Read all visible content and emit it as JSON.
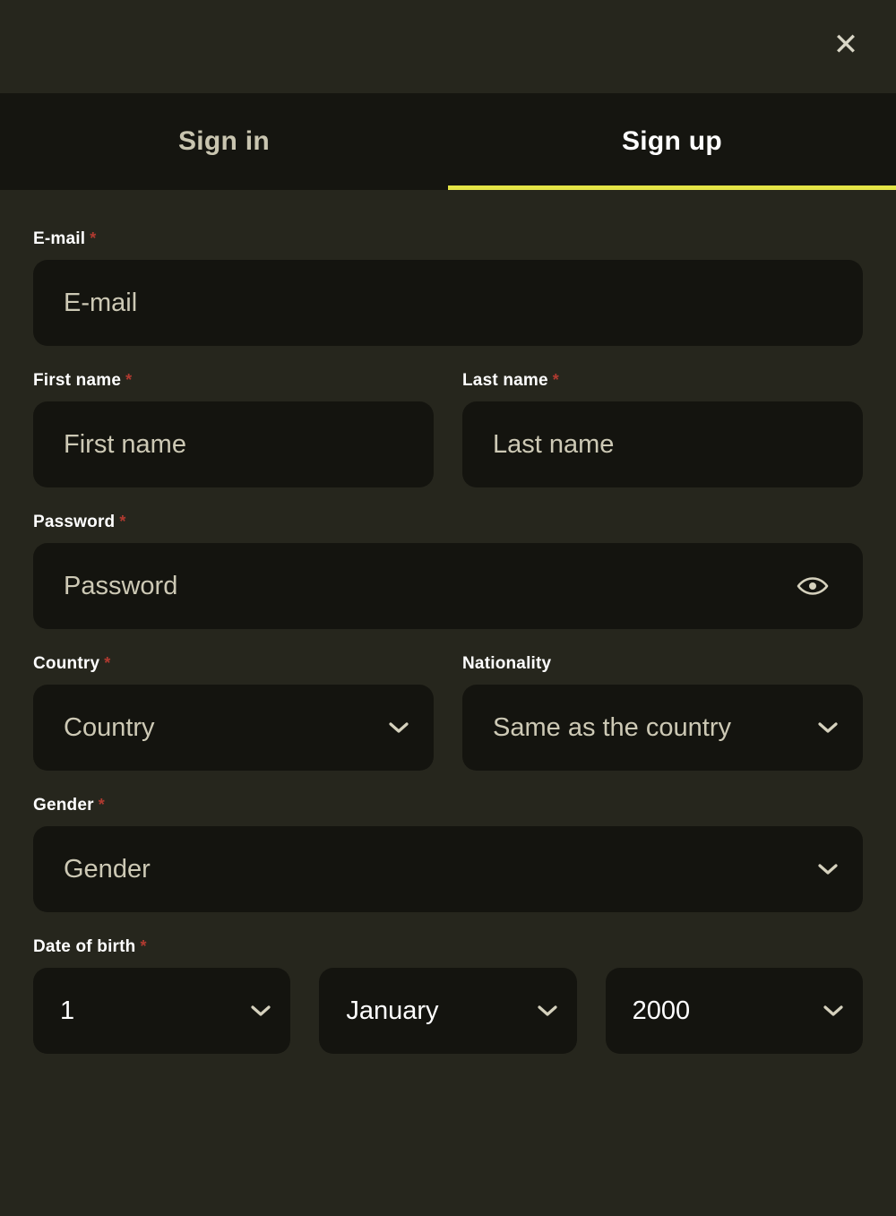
{
  "dialog": {
    "close_label": "✕",
    "close_icon": "close-icon"
  },
  "tabs": [
    {
      "label": "Sign in",
      "active": false
    },
    {
      "label": "Sign up",
      "active": true
    }
  ],
  "accent_color": "#e4e446",
  "required_marker": "*",
  "form": {
    "email": {
      "label": "E-mail",
      "required": true,
      "placeholder": "E-mail",
      "value": ""
    },
    "first_name": {
      "label": "First name",
      "required": true,
      "placeholder": "First name",
      "value": ""
    },
    "last_name": {
      "label": "Last name",
      "required": true,
      "placeholder": "Last name",
      "value": ""
    },
    "password": {
      "label": "Password",
      "required": true,
      "placeholder": "Password",
      "value": "",
      "toggle_icon": "eye-icon"
    },
    "country": {
      "label": "Country",
      "required": true,
      "placeholder": "Country",
      "value": "",
      "chevron_icon": "chevron-down-icon"
    },
    "nationality": {
      "label": "Nationality",
      "required": false,
      "placeholder": "Same as the country",
      "value": "Same as the country",
      "chevron_icon": "chevron-down-icon"
    },
    "gender": {
      "label": "Gender",
      "required": true,
      "placeholder": "Gender",
      "value": "",
      "chevron_icon": "chevron-down-icon"
    },
    "date_of_birth": {
      "label": "Date of birth",
      "required": true,
      "day": "1",
      "month": "January",
      "year": "2000",
      "chevron_icon": "chevron-down-icon"
    }
  },
  "colors": {
    "modal_bg": "#26261d",
    "tabbar_bg": "#151510",
    "input_bg": "#14140f",
    "label": "#ffffff",
    "placeholder": "#cdc9b5",
    "required_star": "#b03a30",
    "accent": "#e4e446"
  }
}
